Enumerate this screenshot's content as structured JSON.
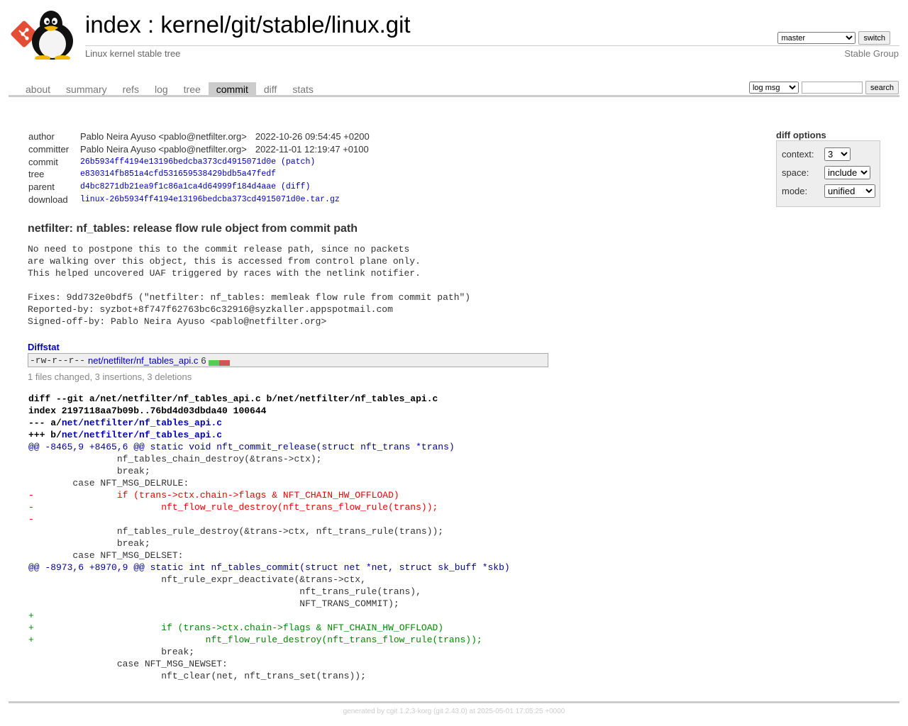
{
  "header": {
    "index_link": "index",
    "separator": " : ",
    "repo_path": "kernel/git/stable/linux.git",
    "subtitle": "Linux kernel stable tree",
    "owner": "Stable Group",
    "branch_selected": "master",
    "switch_label": "switch"
  },
  "tabs": [
    {
      "label": "about",
      "active": false
    },
    {
      "label": "summary",
      "active": false
    },
    {
      "label": "refs",
      "active": false
    },
    {
      "label": "log",
      "active": false
    },
    {
      "label": "tree",
      "active": false
    },
    {
      "label": "commit",
      "active": true
    },
    {
      "label": "diff",
      "active": false
    },
    {
      "label": "stats",
      "active": false
    }
  ],
  "search": {
    "type_selected": "log msg",
    "query": "",
    "button_label": "search"
  },
  "commit_info": {
    "author_label": "author",
    "author": "Pablo Neira Ayuso <pablo@netfilter.org>",
    "author_date": "2022-10-26 09:54:45 +0200",
    "committer_label": "committer",
    "committer": "Pablo Neira Ayuso <pablo@netfilter.org>",
    "committer_date": "2022-11-01 12:19:47 +0100",
    "commit_label": "commit",
    "commit_hash": "26b5934ff4194e13196bedcba373cd4915071d0e",
    "commit_extra": "(patch)",
    "tree_label": "tree",
    "tree_hash": "e830314fb851a4cfd531659538429bdb5a47fedf",
    "parent_label": "parent",
    "parent_hash": "d4bc8271db21ea9f1c86a1ca4d64999f184d4aae",
    "parent_extra": "(diff)",
    "download_label": "download",
    "download_file": "linux-26b5934ff4194e13196bedcba373cd4915071d0e.tar.gz"
  },
  "diff_options": {
    "title": "diff options",
    "context_label": "context:",
    "context_value": "3",
    "space_label": "space:",
    "space_value": "include",
    "mode_label": "mode:",
    "mode_value": "unified"
  },
  "subject": "netfilter: nf_tables: release flow rule object from commit path",
  "message": "No need to postpone this to the commit release path, since no packets\nare walking over this object, this is accessed from control plane only.\nThis helped uncovered UAF triggered by races with the netlink notifier.\n\nFixes: 9dd732e0bdf5 (\"netfilter: nf_tables: memleak flow rule from commit path\")\nReported-by: syzbot+8f747f62763bc6c32916@syzkaller.appspotmail.com\nSigned-off-by: Pablo Neira Ayuso <pablo@netfilter.org>",
  "diffstat": {
    "header": "Diffstat",
    "mode": "-rw-r--r--",
    "path": "net/netfilter/nf_tables_api.c",
    "count": "6",
    "insertions": 3,
    "deletions": 3,
    "summary": "1 files changed, 3 insertions, 3 deletions"
  },
  "diff": {
    "line1": "diff --git a/net/netfilter/nf_tables_api.c b/net/netfilter/nf_tables_api.c",
    "line2": "index 2197118aa7b09b..76bd4d03dbda40 100644",
    "minus_prefix": "--- a/",
    "plus_prefix": "+++ b/",
    "file_path": "net/netfilter/nf_tables_api.c",
    "lines": [
      {
        "type": "hunk",
        "text": "@@ -8465,9 +8465,6 @@ static void nft_commit_release(struct nft_trans *trans)"
      },
      {
        "type": "ctx",
        "text": " \t\tnf_tables_chain_destroy(&trans->ctx);"
      },
      {
        "type": "ctx",
        "text": " \t\tbreak;"
      },
      {
        "type": "ctx",
        "text": " \tcase NFT_MSG_DELRULE:"
      },
      {
        "type": "del",
        "text": "-\t\tif (trans->ctx.chain->flags & NFT_CHAIN_HW_OFFLOAD)"
      },
      {
        "type": "del",
        "text": "-\t\t\tnft_flow_rule_destroy(nft_trans_flow_rule(trans));"
      },
      {
        "type": "del",
        "text": "-"
      },
      {
        "type": "ctx",
        "text": " \t\tnf_tables_rule_destroy(&trans->ctx, nft_trans_rule(trans));"
      },
      {
        "type": "ctx",
        "text": " \t\tbreak;"
      },
      {
        "type": "ctx",
        "text": " \tcase NFT_MSG_DELSET:"
      },
      {
        "type": "hunk",
        "text": "@@ -8973,6 +8970,9 @@ static int nf_tables_commit(struct net *net, struct sk_buff *skb)"
      },
      {
        "type": "ctx",
        "text": " \t\t\tnft_rule_expr_deactivate(&trans->ctx,"
      },
      {
        "type": "ctx",
        "text": " \t\t\t\t\t\t nft_trans_rule(trans),"
      },
      {
        "type": "ctx",
        "text": " \t\t\t\t\t\t NFT_TRANS_COMMIT);"
      },
      {
        "type": "add",
        "text": "+"
      },
      {
        "type": "add",
        "text": "+\t\t\tif (trans->ctx.chain->flags & NFT_CHAIN_HW_OFFLOAD)"
      },
      {
        "type": "add",
        "text": "+\t\t\t\tnft_flow_rule_destroy(nft_trans_flow_rule(trans));"
      },
      {
        "type": "ctx",
        "text": " \t\t\tbreak;"
      },
      {
        "type": "ctx",
        "text": " \t\tcase NFT_MSG_NEWSET:"
      },
      {
        "type": "ctx",
        "text": " \t\t\tnft_clear(net, nft_trans_set(trans));"
      }
    ]
  },
  "footer": {
    "generated_by": "generated by ",
    "cgit": "cgit 1.2.3-korg",
    "git": "(git 2.43.0)",
    "at": " at 2025-05-01 17:05:25 +0000"
  },
  "colors": {
    "add": "#008800",
    "del": "#ee0000",
    "hunk": "#000090",
    "link": "#0000bb",
    "active_tab_bg": "#cccccc"
  }
}
